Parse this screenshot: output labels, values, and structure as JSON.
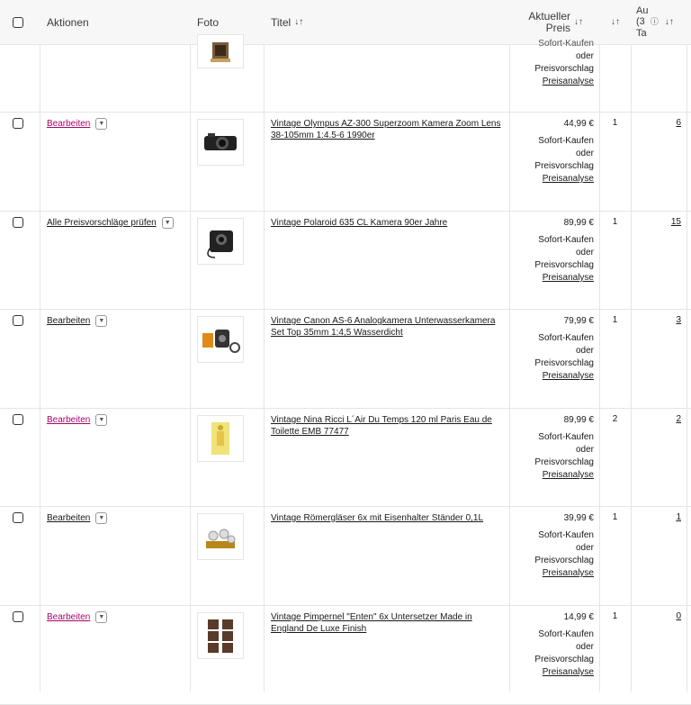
{
  "header": {
    "aktionen": "Aktionen",
    "foto": "Foto",
    "titel": "Titel",
    "preis_line1": "Aktueller",
    "preis_line2": "Preis",
    "last_line1": "Au",
    "last_line2": "(3",
    "last_line3": "Ta",
    "sort_icon": "↓↑"
  },
  "top_partial": {
    "fmt_partial": "Sofort-Kaufen",
    "fmt_oder": "oder",
    "fmt_vorschlag": "Preisvorschlag",
    "analyse": "Preisanalyse"
  },
  "rows": [
    {
      "action": "Bearbeiten",
      "title": "Vintage Olympus AZ-300 Superzoom Kamera Zoom Lens 38-105mm 1:4.5-6 1990er",
      "price": "44,99 €",
      "qty": "1",
      "count": "6"
    },
    {
      "action": "Alle Preisvorschläge prüfen",
      "title": "Vintage Polaroid 635 CL Kamera 90er Jahre",
      "price": "89,99 €",
      "qty": "1",
      "count": "15"
    },
    {
      "action": "Bearbeiten",
      "title": "Vintage Canon AS-6 Analogkamera Unterwasserkamera Set Top 35mm 1:4,5 Wasserdicht",
      "price": "79,99 €",
      "qty": "1",
      "count": "3"
    },
    {
      "action": "Bearbeiten",
      "title": "Vintage Nina Ricci L´Air Du Temps 120 ml Paris Eau de Toilette EMB 77477",
      "price": "89,99 €",
      "qty": "2",
      "count": "2"
    },
    {
      "action": "Bearbeiten",
      "title": "Vintage Römergläser 6x mit Eisenhalter Ständer 0,1L",
      "price": "39,99 €",
      "qty": "1",
      "count": "1"
    },
    {
      "action": "Bearbeiten",
      "title": "Vintage Pimpernel \"Enten\" 6x Untersetzer Made in England De Luxe Finish",
      "price": "14,99 €",
      "qty": "1",
      "count": "0"
    }
  ],
  "format": {
    "line1": "Sofort-Kaufen",
    "line2": "oder",
    "line3": "Preisvorschlag",
    "analyse": "Preisanalyse"
  },
  "colors": {
    "link_pink": "#a4076a",
    "border": "#e5e5e5",
    "header_bg": "#f7f7f7"
  }
}
